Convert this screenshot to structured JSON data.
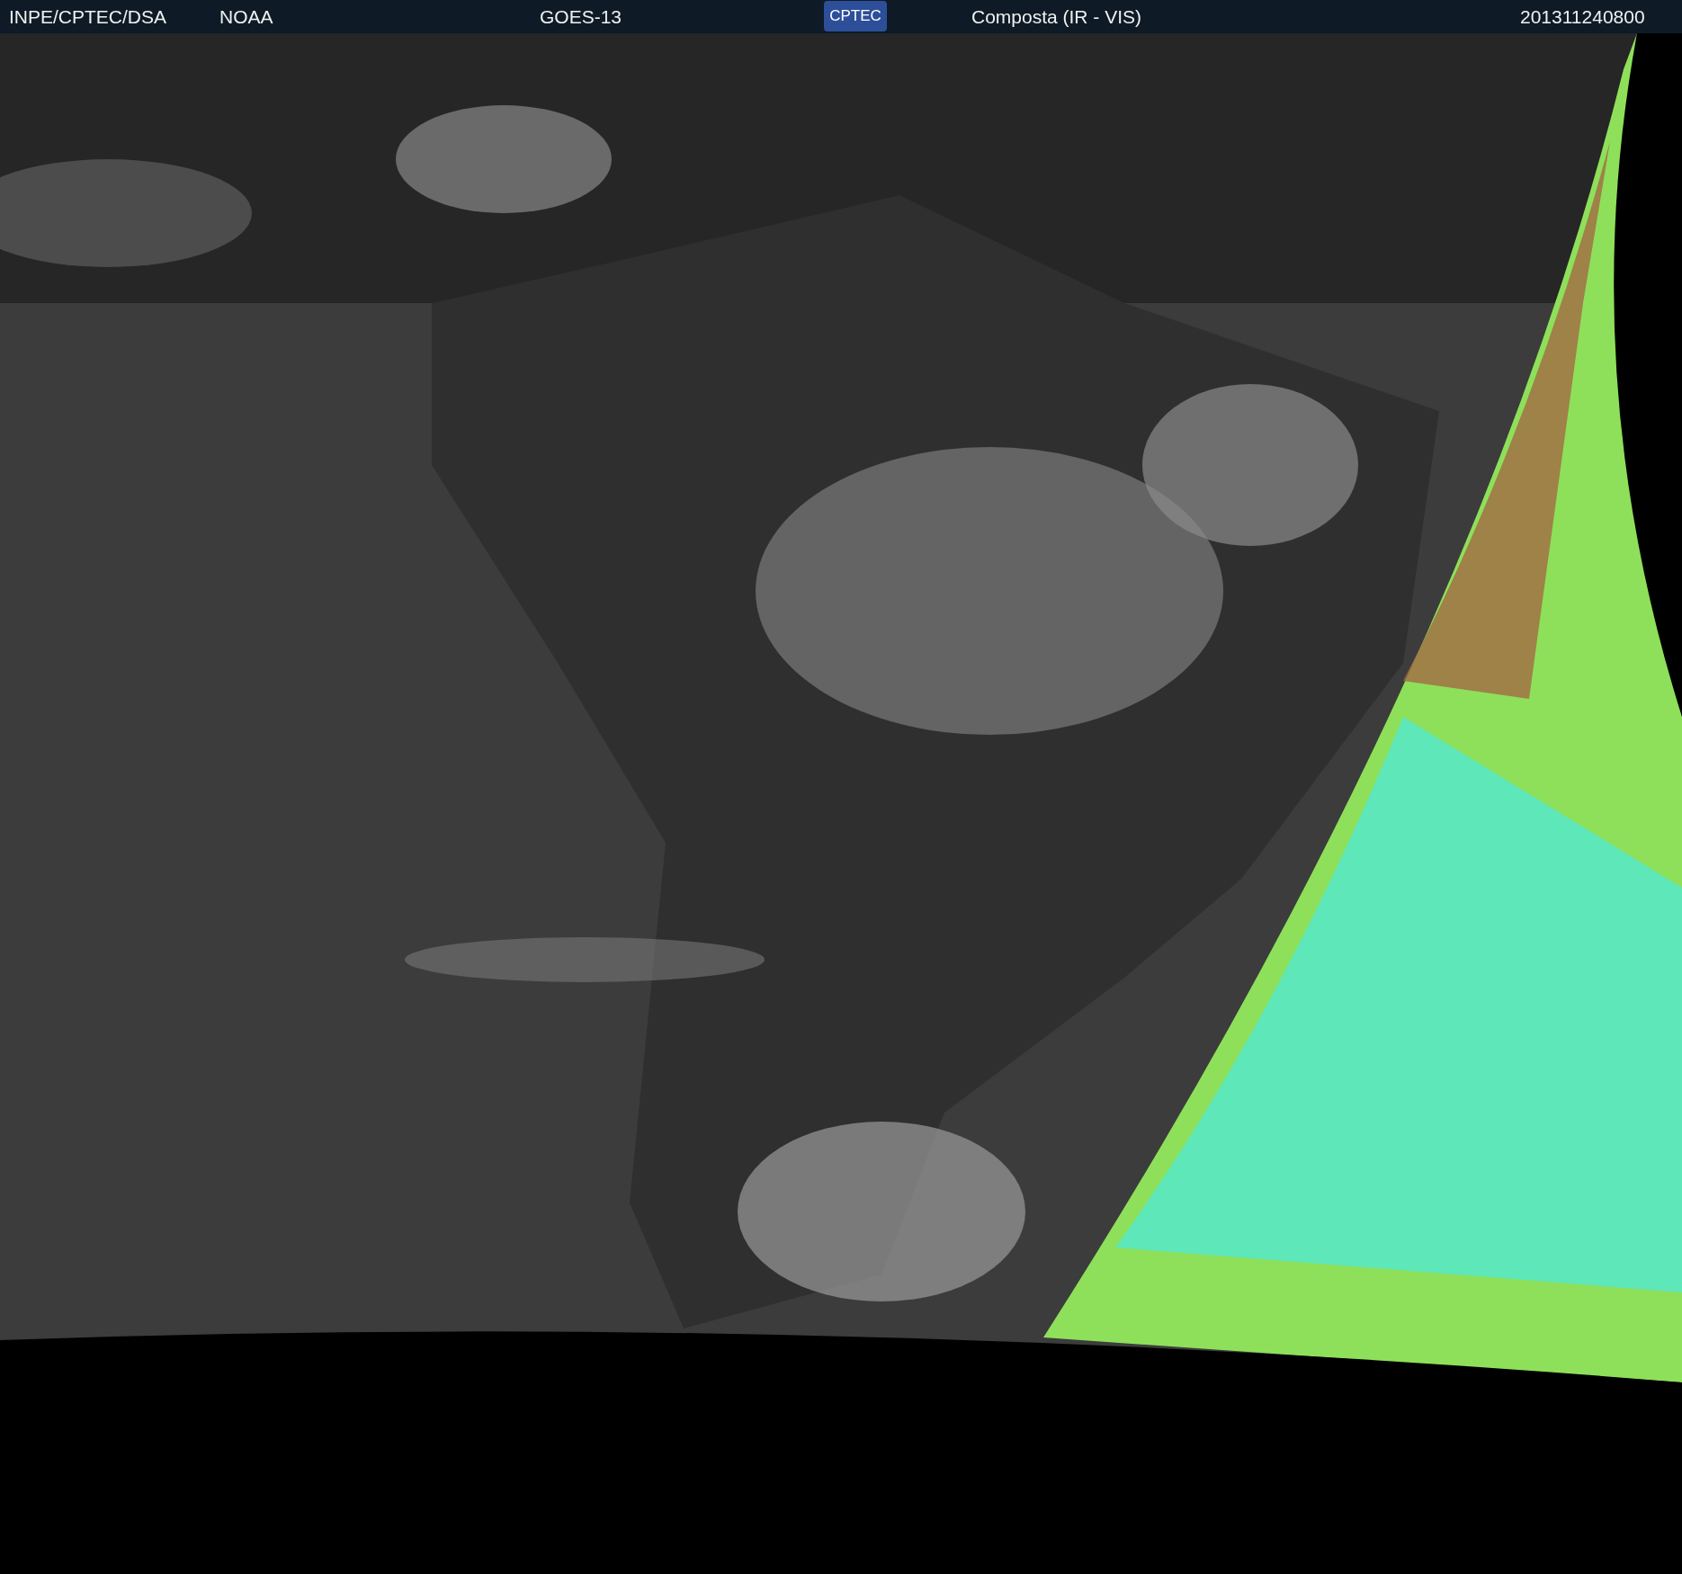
{
  "header": [
    {
      "kind": "text",
      "label": "INPE/CPTEC/DSA"
    },
    {
      "kind": "text",
      "label": "NOAA"
    },
    {
      "kind": "text",
      "label": "GOES-13"
    },
    {
      "kind": "logo",
      "label": "CPTEC"
    },
    {
      "kind": "text",
      "label": "Composta (IR - VIS)"
    },
    {
      "kind": "text",
      "label": "201311240800"
    }
  ]
}
